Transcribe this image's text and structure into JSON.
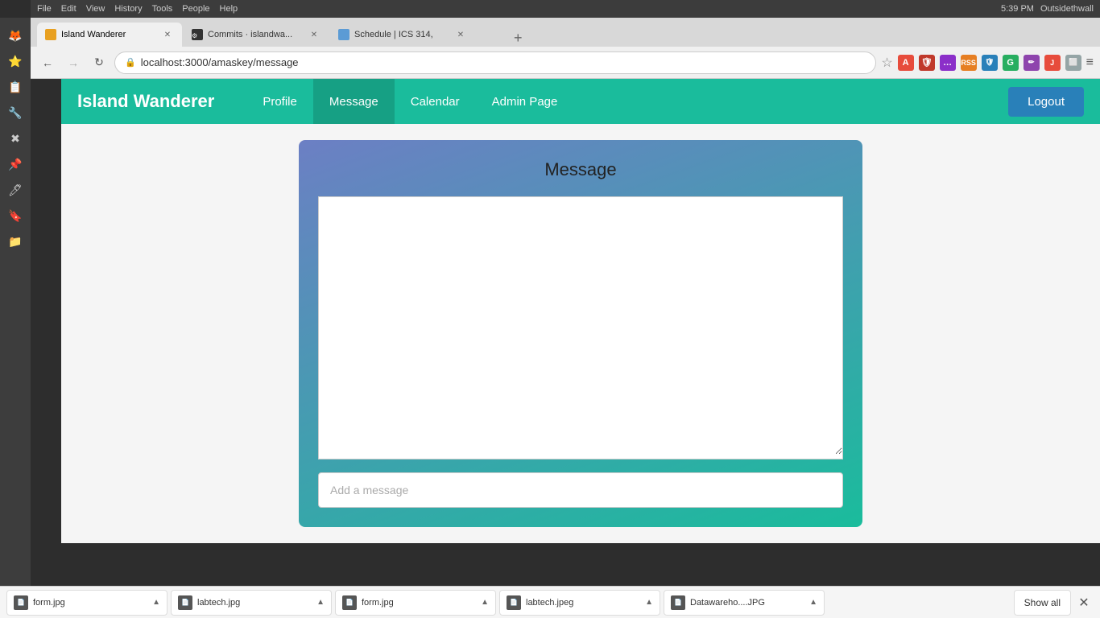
{
  "os": {
    "topbar_left": [
      "File",
      "Edit",
      "View",
      "History",
      "Tools",
      "People",
      "Help"
    ],
    "topbar_right": "5:39 PM",
    "user": "Outsidethwall"
  },
  "browser": {
    "tabs": [
      {
        "id": "tab1",
        "favicon_color": "#e8a020",
        "title": "Island Wanderer",
        "active": true
      },
      {
        "id": "tab2",
        "favicon_color": "#333",
        "title": "Commits · islandwa...",
        "active": false
      },
      {
        "id": "tab3",
        "favicon_color": "#5b9bd5",
        "title": "Schedule | ICS 314,",
        "active": false
      }
    ],
    "url": "localhost:3000/amaskey/message"
  },
  "app": {
    "brand": "Island Wanderer",
    "nav": [
      {
        "label": "Profile",
        "active": false
      },
      {
        "label": "Message",
        "active": true
      },
      {
        "label": "Calendar",
        "active": false
      },
      {
        "label": "Admin Page",
        "active": false
      }
    ],
    "logout_label": "Logout"
  },
  "message_page": {
    "title": "Message",
    "textarea_placeholder": "",
    "input_placeholder": "Add a message"
  },
  "downloads": {
    "items": [
      {
        "name": "form.jpg"
      },
      {
        "name": "labtech.jpg"
      },
      {
        "name": "form.jpg"
      },
      {
        "name": "labtech.jpeg"
      },
      {
        "name": "Datawareho....JPG"
      }
    ],
    "show_all_label": "Show all",
    "close_label": "✕"
  }
}
